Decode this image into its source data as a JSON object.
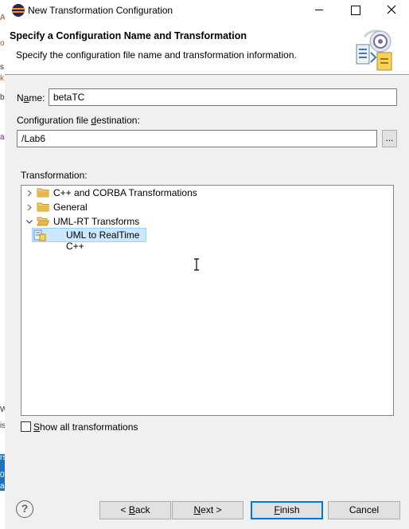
{
  "window": {
    "title": "New Transformation Configuration"
  },
  "header": {
    "title": "Specify a Configuration Name and Transformation",
    "description": "Specify the configuration file name and transformation information."
  },
  "form": {
    "name_label_pre": "N",
    "name_label_ul": "a",
    "name_label_post": "me:",
    "name_value": "betaTC",
    "dest_label_pre": "Configuration file ",
    "dest_label_ul": "d",
    "dest_label_post": "estination:",
    "dest_value": "/Lab6",
    "browse_label": "...",
    "transformation_label": "Transformation:"
  },
  "tree": {
    "items": [
      {
        "label": "C++ and CORBA Transformations",
        "expanded": false,
        "icon": "folder-icon"
      },
      {
        "label": "General",
        "expanded": false,
        "icon": "folder-icon"
      },
      {
        "label": "UML-RT Transforms",
        "expanded": true,
        "icon": "folder-open-icon"
      },
      {
        "label": "UML to RealTime C++",
        "selected": true,
        "icon": "transformation-icon"
      }
    ]
  },
  "options": {
    "show_all_label_ul": "S",
    "show_all_label_post": "how all transformations",
    "show_all_checked": false
  },
  "buttons": {
    "help": "?",
    "back_pre": "< ",
    "back_ul": "B",
    "back_post": "ack",
    "next_ul": "N",
    "next_post": "ext >",
    "finish_ul": "F",
    "finish_post": "inish",
    "cancel": "Cancel"
  },
  "background": {
    "fragments": [
      "A",
      "o",
      "s",
      "k",
      "b",
      "a",
      "W",
      "is",
      "rs",
      "0",
      "al"
    ]
  },
  "colors": {
    "selection": "#cce8ff",
    "selection_border": "#99d1ff",
    "default_button_border": "#0078d7",
    "folder": "#e8b84a"
  }
}
